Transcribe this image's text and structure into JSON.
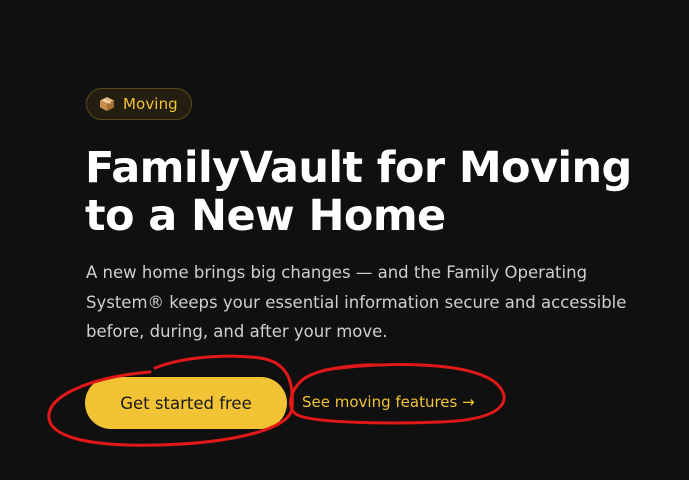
{
  "badge": {
    "icon": "package-box-icon",
    "label": "Moving"
  },
  "hero": {
    "title": "FamilyVault for Moving to a New Home",
    "description": "A new home brings big changes — and the Family Operating System® keeps your essential information secure and accessible before, during, and after your move."
  },
  "actions": {
    "primary_label": "Get started free",
    "secondary_label": "See moving features →"
  },
  "colors": {
    "background": "#111010",
    "accent": "#f2c335",
    "annotation": "#e01818"
  }
}
